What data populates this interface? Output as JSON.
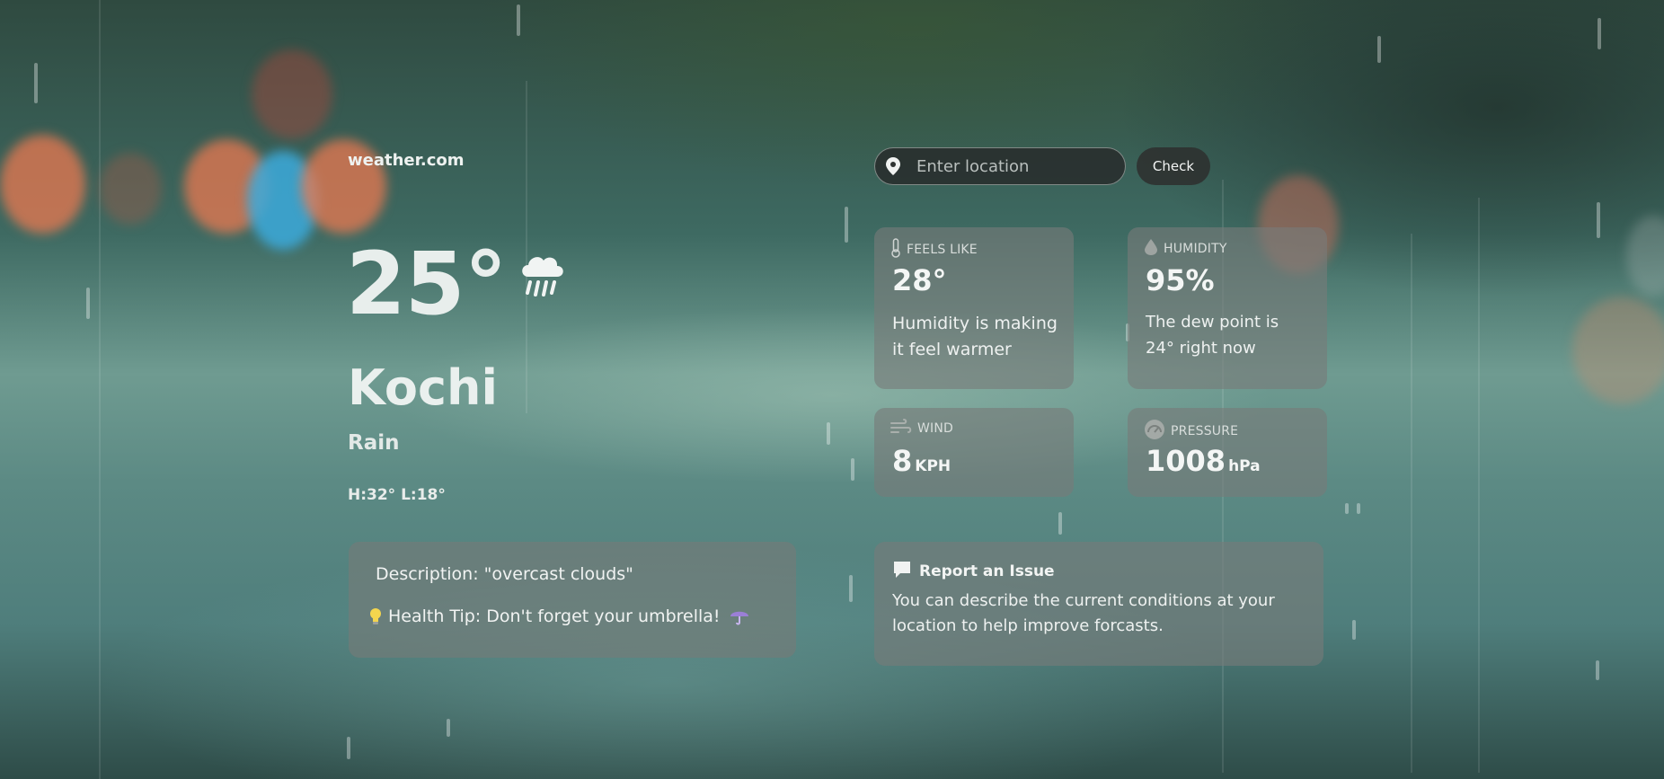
{
  "brand": "weather.com",
  "current": {
    "temperature": "25°",
    "city": "Kochi",
    "condition": "Rain",
    "high_low": "H:32° L:18°",
    "icon": "rain-cloud-icon"
  },
  "description_card": {
    "description": "Description: \"overcast clouds\"",
    "health_tip": "Health Tip: Don't forget your umbrella!"
  },
  "search": {
    "placeholder": "Enter location",
    "value": "",
    "button_label": "Check"
  },
  "stats": {
    "feels_like": {
      "label": "Feels Like",
      "value": "28°",
      "note": "Humidity is making it feel warmer",
      "icon": "thermometer-icon"
    },
    "humidity": {
      "label": "Humidity",
      "value": "95%",
      "note": "The dew point is 24° right now",
      "icon": "droplet-icon"
    },
    "wind": {
      "label": "Wind",
      "value": "8",
      "unit": "KPH",
      "icon": "wind-icon"
    },
    "pressure": {
      "label": "Pressure",
      "value": "1008",
      "unit": "hPa",
      "icon": "gauge-icon"
    }
  },
  "report": {
    "title": "Report an Issue",
    "text": "You can describe the current conditions at your location to help improve forcasts.",
    "icon": "chat-bubble-icon"
  }
}
